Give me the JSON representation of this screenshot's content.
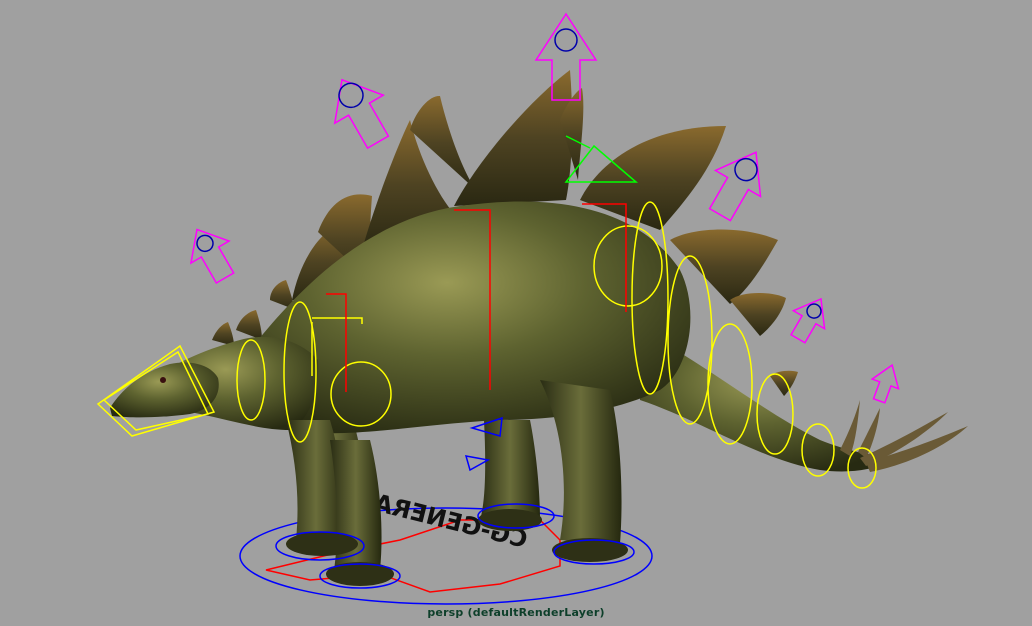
{
  "viewport": {
    "camera_label": "persp (defaultRenderLayer)",
    "background_color": "#a0a0a0"
  },
  "scene": {
    "model": "stegosaurus",
    "ground_logo_text": "CG-GENERATION",
    "colors": {
      "spine_controls": "#ff00ff",
      "body_controls": "#ffff00",
      "ik_handles": "#ff0000",
      "root_control": "#0000ff",
      "head_control": "#00ff00",
      "skin": "#4e5426",
      "plate": "#5a4a22"
    },
    "icons": [
      "magenta-arrow-control-icon",
      "yellow-ring-control-icon",
      "red-ik-handle-icon",
      "blue-root-circle-icon",
      "green-triangle-control-icon"
    ]
  }
}
